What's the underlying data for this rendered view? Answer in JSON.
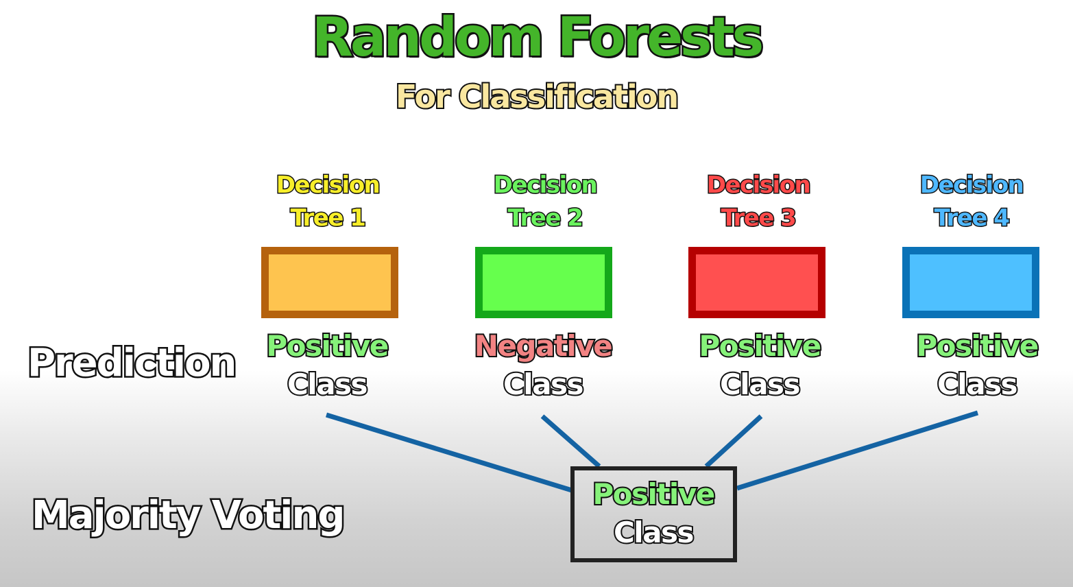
{
  "title": "Random Forests",
  "subtitle": "For Classification",
  "row_labels": {
    "prediction": "Prediction",
    "majority_voting": "Majority Voting"
  },
  "trees": [
    {
      "line1": "Decision",
      "line2": "Tree 1",
      "label_color": "#f7ee2a",
      "fill": "#fec44f",
      "border": "#b5620d",
      "prediction_word": "Positive",
      "prediction_class": "Class",
      "prediction_color": "#86f27a"
    },
    {
      "line1": "Decision",
      "line2": "Tree 2",
      "label_color": "#6af25e",
      "fill": "#66ff4d",
      "border": "#14a81a",
      "prediction_word": "Negative",
      "prediction_class": "Class",
      "prediction_color": "#f28383"
    },
    {
      "line1": "Decision",
      "line2": "Tree 3",
      "label_color": "#ff4a4a",
      "fill": "#ff5050",
      "border": "#b50000",
      "prediction_word": "Positive",
      "prediction_class": "Class",
      "prediction_color": "#86f27a"
    },
    {
      "line1": "Decision",
      "line2": "Tree 4",
      "label_color": "#4fb8ff",
      "fill": "#4ec0ff",
      "border": "#0a72b7",
      "prediction_word": "Positive",
      "prediction_class": "Class",
      "prediction_color": "#86f27a"
    }
  ],
  "result": {
    "word": "Positive",
    "class": "Class",
    "color": "#86f27a"
  },
  "colors": {
    "connector": "#1463a3"
  }
}
